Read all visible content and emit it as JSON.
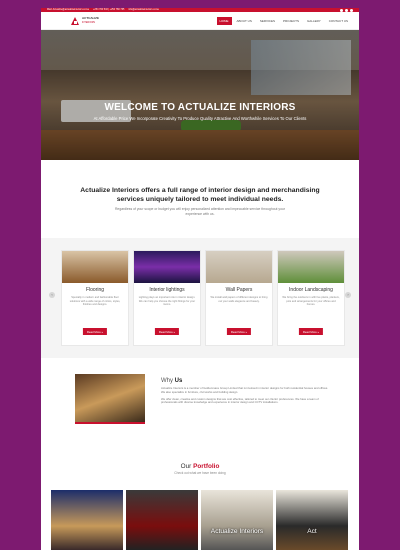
{
  "topbar": {
    "email": "Mail: Actualize@actualizeinteriors.co.ke",
    "phone": "+254 700 543 | +254 780 765",
    "website": "info@actualizeinteriors.co.ke"
  },
  "brand": {
    "name": "ACTUALIZE",
    "tagline": "INTERIORS"
  },
  "nav": {
    "items": [
      {
        "label": "Home",
        "active": true
      },
      {
        "label": "About Us",
        "active": false
      },
      {
        "label": "Services",
        "active": false
      },
      {
        "label": "Projects",
        "active": false
      },
      {
        "label": "Gallery",
        "active": false
      },
      {
        "label": "Contact Us",
        "active": false
      }
    ]
  },
  "hero": {
    "title": "WELCOME TO ACTUALIZE INTERIORS",
    "subtitle": "At Affordable Price We Incorporate Creativity To Produce Quality Attractive And Worthwhile Services To Our Clients"
  },
  "intro": {
    "headline": "Actualize Interiors offers a full range of interior design and merchandising services uniquely tailored to meet individual needs.",
    "body": "Regardless of your scope or budget you will enjoy personalized attention and impeccable service throughout your experience with us."
  },
  "services": {
    "items": [
      {
        "title": "Flooring",
        "desc": "Specialty in modern and fashionable floor solutions with a wide range of colors, styles, finishes and designs.",
        "button": "Read More »"
      },
      {
        "title": "Interior lightings",
        "desc": "Lighting plays an important role in interior design. We can help you choose the right fittings for your rooms.",
        "button": "Read More »"
      },
      {
        "title": "Wall Papers",
        "desc": "We install wall papers of different designs to bring out your walls elegance and beauty.",
        "button": "Read More »"
      },
      {
        "title": "Indoor Landscaping",
        "desc": "We bring the outdoors in with live plants, planters, pots and arrangements for your offices and homes.",
        "button": "Read More »"
      }
    ],
    "prev_icon": "‹",
    "next_icon": "›"
  },
  "why": {
    "title_light": "Why",
    "title_bold": "Us",
    "para1": "Actualize Interiors is a member of Goldenmace Group Limited that is involved in interior designs for both residential houses and offices. We also specialize in furniture, civil works and building design.",
    "para2": "We offer clean, creative and custom designs that are cost effective, tailored to meet our clients' preferences. We have a team of professionals with diverse knowledge and experience in interior design and CCTV installations."
  },
  "portfolio": {
    "title_plain": "Our",
    "title_accent": "Portfolio",
    "subtitle": "Check out what we have been doing",
    "items": [
      {
        "caption": ""
      },
      {
        "caption": ""
      },
      {
        "caption": "Actualize Interiors"
      },
      {
        "caption": "Act"
      }
    ]
  },
  "colors": {
    "accent": "#c8102e",
    "frame": "#7d1a70"
  }
}
